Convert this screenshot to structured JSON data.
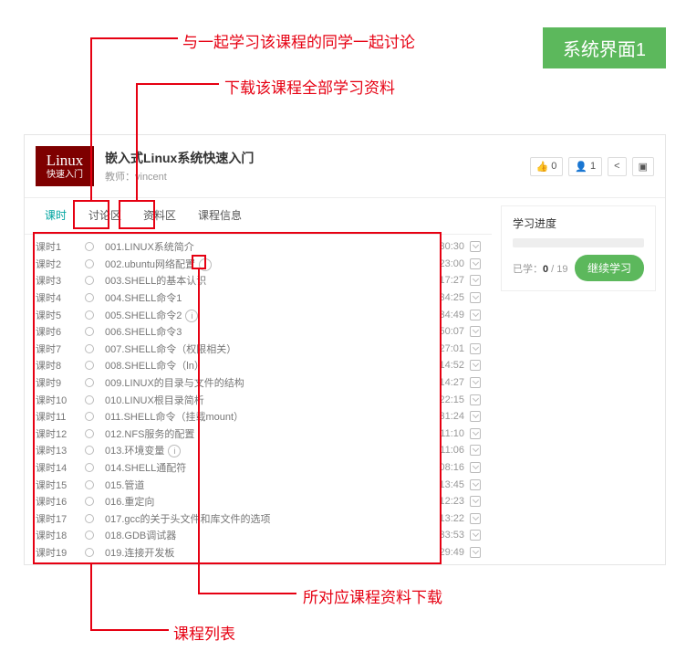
{
  "badge": "系统界面1",
  "annotations": {
    "discuss": "与一起学习该课程的同学一起讨论",
    "materials": "下载该课程全部学习资料",
    "lessonDl": "所对应课程资料下载",
    "list": "课程列表"
  },
  "course": {
    "logo_line1": "Linux",
    "logo_line2": "快速入门",
    "title": "嵌入式Linux系统快速入门",
    "teacher_label": "教师：",
    "teacher": "vincent"
  },
  "stats": {
    "like_icon": "👍",
    "like_count": "0",
    "user_icon": "👤",
    "user_count": "1",
    "share_icon": "<",
    "menu_icon": "▣"
  },
  "tabs": [
    "课时",
    "讨论区",
    "资料区",
    "课程信息"
  ],
  "lessons": [
    {
      "num": "课时1",
      "name": "001.LINUX系统简介",
      "time": "30:30",
      "info": false
    },
    {
      "num": "课时2",
      "name": "002.ubuntu网络配置",
      "time": "23:00",
      "info": true
    },
    {
      "num": "课时3",
      "name": "003.SHELL的基本认识",
      "time": "17:27",
      "info": false
    },
    {
      "num": "课时4",
      "name": "004.SHELL命令1",
      "time": "34:25",
      "info": false
    },
    {
      "num": "课时5",
      "name": "005.SHELL命令2",
      "time": "34:49",
      "info": true
    },
    {
      "num": "课时6",
      "name": "006.SHELL命令3",
      "time": "50:07",
      "info": false
    },
    {
      "num": "课时7",
      "name": "007.SHELL命令（权限相关）",
      "time": "27:01",
      "info": false
    },
    {
      "num": "课时8",
      "name": "008.SHELL命令（ln）",
      "time": "14:52",
      "info": false
    },
    {
      "num": "课时9",
      "name": "009.LINUX的目录与文件的结构",
      "time": "14:27",
      "info": false
    },
    {
      "num": "课时10",
      "name": "010.LINUX根目录简析",
      "time": "22:15",
      "info": false
    },
    {
      "num": "课时11",
      "name": "011.SHELL命令（挂载mount）",
      "time": "31:24",
      "info": false
    },
    {
      "num": "课时12",
      "name": "012.NFS服务的配置",
      "time": "11:10",
      "info": false
    },
    {
      "num": "课时13",
      "name": "013.环境变量",
      "time": "11:06",
      "info": true
    },
    {
      "num": "课时14",
      "name": "014.SHELL通配符",
      "time": "08:16",
      "info": false
    },
    {
      "num": "课时15",
      "name": "015.管道",
      "time": "13:45",
      "info": false
    },
    {
      "num": "课时16",
      "name": "016.重定向",
      "time": "12:23",
      "info": false
    },
    {
      "num": "课时17",
      "name": "017.gcc的关于头文件和库文件的选项",
      "time": "13:22",
      "info": false
    },
    {
      "num": "课时18",
      "name": "018.GDB调试器",
      "time": "33:53",
      "info": false
    },
    {
      "num": "课时19",
      "name": "019.连接开发板",
      "time": "29:49",
      "info": false
    }
  ],
  "progress": {
    "title": "学习进度",
    "studied_label": "已学：",
    "studied": "0",
    "sep": " / ",
    "total": "19",
    "button": "继续学习"
  }
}
